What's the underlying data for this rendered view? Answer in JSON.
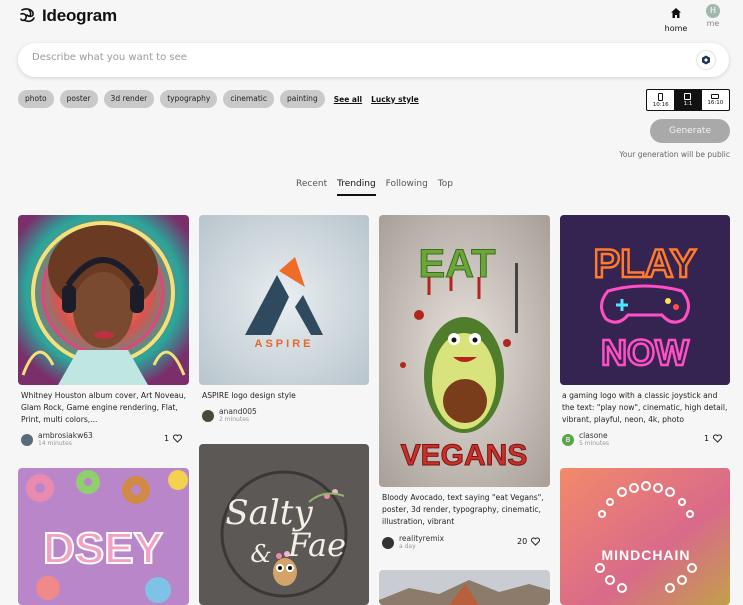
{
  "app": {
    "title": "Ideogram"
  },
  "nav": {
    "home_label": "home",
    "me_label": "me",
    "avatar_initial": "H"
  },
  "search": {
    "placeholder": "Describe what you want to see",
    "value": ""
  },
  "chips": [
    "photo",
    "poster",
    "3d render",
    "typography",
    "cinematic",
    "painting"
  ],
  "links": {
    "see_all": "See all",
    "lucky": "Lucky style"
  },
  "ratios": [
    {
      "label": "10:16",
      "selected": false
    },
    {
      "label": "1:1",
      "selected": true
    },
    {
      "label": "16:10",
      "selected": false
    }
  ],
  "generate": {
    "label": "Generate",
    "note": "Your generation will be public"
  },
  "tabs": [
    {
      "label": "Recent",
      "active": false
    },
    {
      "label": "Trending",
      "active": true
    },
    {
      "label": "Following",
      "active": false
    },
    {
      "label": "Top",
      "active": false
    }
  ],
  "cards": [
    {
      "caption": "Whitney Houston album cover, Art Noveau, Glam Rock, Game engine rendering, Flat, Print, multi colors,...",
      "user": "ambrosiakw63",
      "time": "14 minutes",
      "likes": "1"
    },
    {
      "caption": "ASPIRE logo design style",
      "image_text": "ASPIRE",
      "user": "anand005",
      "time": "2 minutes"
    },
    {
      "caption": "Bloody Avocado, text saying \"eat Vegans\", poster, 3d render, typography, cinematic, illustration, vibrant",
      "image_text_top": "EAT",
      "image_text_bottom": "VEGANS",
      "user": "realityremix",
      "time": "a day",
      "likes": "20"
    },
    {
      "caption": "a gaming logo with a classic joystick and the text: \"play now\", cinematic, high detail, vibrant, playful, neon, 4k, photo",
      "image_text_top": "PLAY",
      "image_text_bottom": "NOW",
      "user": "clasone",
      "user_initial": "B",
      "time": "5 minutes",
      "likes": "1"
    },
    {
      "image_text": "DSEY"
    },
    {
      "image_text_top": "Salty",
      "image_text_mid": "&",
      "image_text_bottom": "Fae"
    },
    {
      "image_text": "MINDCHAIN"
    }
  ],
  "colors": {
    "accent": "#111111",
    "chip_bg": "#c9c9c9",
    "button_disabled": "#a9a9a9"
  }
}
